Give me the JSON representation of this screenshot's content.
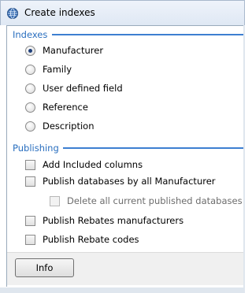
{
  "window": {
    "title": "Create indexes"
  },
  "indexes": {
    "header": "Indexes",
    "options": [
      {
        "label": "Manufacturer",
        "checked": true
      },
      {
        "label": "Family",
        "checked": false
      },
      {
        "label": "User defined field",
        "checked": false
      },
      {
        "label": "Reference",
        "checked": false
      },
      {
        "label": "Description",
        "checked": false
      }
    ]
  },
  "publishing": {
    "header": "Publishing",
    "options": [
      {
        "label": "Add Included columns",
        "checked": false,
        "enabled": true
      },
      {
        "label": "Publish databases by all Manufacturer",
        "checked": false,
        "enabled": true
      },
      {
        "label": "Delete all current published databases",
        "checked": false,
        "enabled": false
      },
      {
        "label": "Publish Rebates manufacturers",
        "checked": false,
        "enabled": true
      },
      {
        "label": "Publish Rebate codes",
        "checked": false,
        "enabled": true
      }
    ]
  },
  "footer": {
    "info_label": "Info"
  },
  "icons": {
    "app": "globe-icon"
  },
  "colors": {
    "group_header": "#2a6fbf",
    "group_line": "#3d7fd1"
  }
}
